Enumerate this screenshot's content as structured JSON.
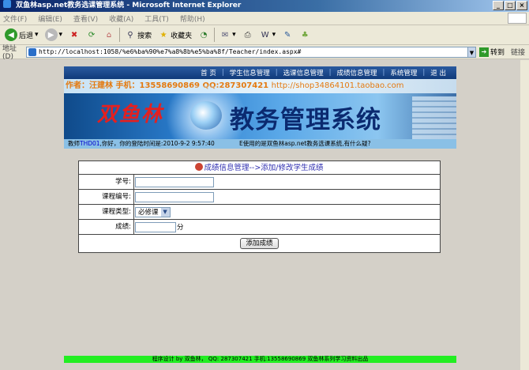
{
  "window": {
    "title": "双鱼林asp.net教务选课管理系统 - Microsoft Internet Explorer"
  },
  "menu": [
    "文件(F)",
    "编辑(E)",
    "查看(V)",
    "收藏(A)",
    "工具(T)",
    "帮助(H)"
  ],
  "toolbar": {
    "back": "后退",
    "search": "搜索",
    "favorites": "收藏夹"
  },
  "address": {
    "label": "地址(D)",
    "url": "http://localhost:1058/%e6%ba%90%e7%a8%8b%e5%ba%8f/Teacher/index.aspx#",
    "go": "转到",
    "links": "链接"
  },
  "nav": [
    "首 页",
    "学生信息管理",
    "选课信息管理",
    "成绩信息管理",
    "系统管理",
    "退 出"
  ],
  "banner": {
    "author": "作者：汪建林  手机：13558690869 QQ:287307421",
    "url": "http://shop34864101.taobao.com",
    "brand": "双鱼林",
    "system": "教务管理系统"
  },
  "status": {
    "prefix": "教师",
    "user": "THD01",
    "rest": ",你好，你的登陆时间是:2010-9-2 9:57:40",
    "marquee": "E使用的是双鱼林asp.net教务选课系统,有什么疑?"
  },
  "form": {
    "title": "成绩信息管理-->添加/修改学生成绩",
    "student_label": "学号:",
    "course_label": "课程编号:",
    "type_label": "课程类型:",
    "type_value": "必修课",
    "score_label": "成绩:",
    "score_unit": "分",
    "submit": "添加成绩"
  },
  "footer": "程序设计 by 双鱼林， QQ: 287307421 手机:13558690869 双鱼林系列学习资料出品"
}
